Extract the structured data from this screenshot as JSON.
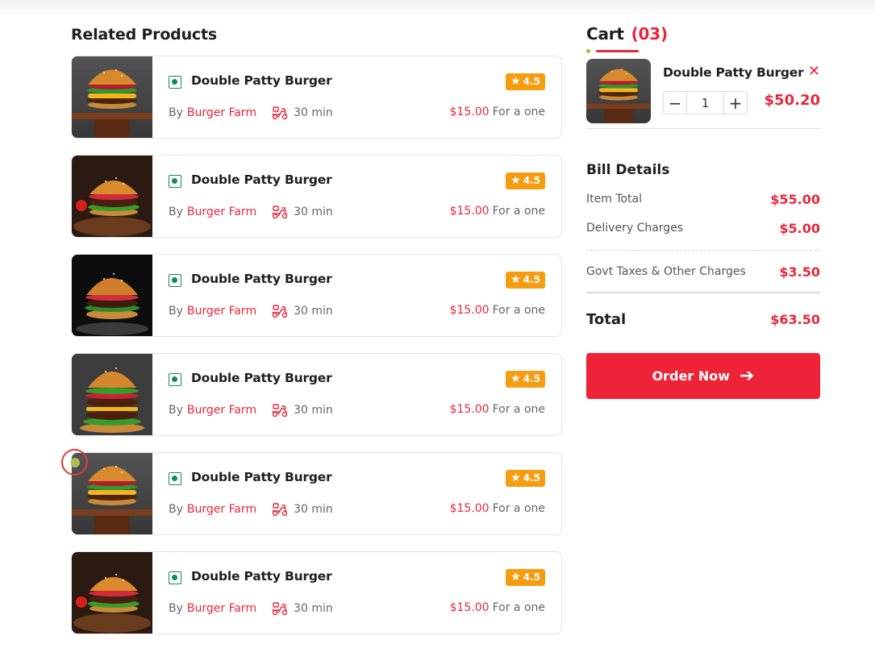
{
  "related": {
    "title": "Related Products",
    "products": [
      {
        "name": "Double Patty Burger",
        "rating": "4.5",
        "by_label": "By",
        "brand": "Burger Farm",
        "time": "30 min",
        "price": "$15.00",
        "price_suffix": "For a one",
        "image": "burger-image-1"
      },
      {
        "name": "Double Patty Burger",
        "rating": "4.5",
        "by_label": "By",
        "brand": "Burger Farm",
        "time": "30 min",
        "price": "$15.00",
        "price_suffix": "For a one",
        "image": "burger-image-2"
      },
      {
        "name": "Double Patty Burger",
        "rating": "4.5",
        "by_label": "By",
        "brand": "Burger Farm",
        "time": "30 min",
        "price": "$15.00",
        "price_suffix": "For a one",
        "image": "burger-image-3"
      },
      {
        "name": "Double Patty Burger",
        "rating": "4.5",
        "by_label": "By",
        "brand": "Burger Farm",
        "time": "30 min",
        "price": "$15.00",
        "price_suffix": "For a one",
        "image": "burger-image-4"
      },
      {
        "name": "Double Patty Burger",
        "rating": "4.5",
        "by_label": "By",
        "brand": "Burger Farm",
        "time": "30 min",
        "price": "$15.00",
        "price_suffix": "For a one",
        "image": "burger-image-5"
      },
      {
        "name": "Double Patty Burger",
        "rating": "4.5",
        "by_label": "By",
        "brand": "Burger Farm",
        "time": "30 min",
        "price": "$15.00",
        "price_suffix": "For a one",
        "image": "burger-image-6"
      }
    ]
  },
  "cart": {
    "title": "Cart",
    "count": "(03)",
    "item": {
      "name": "Double Patty Burger",
      "quantity": "1",
      "total": "$50.20",
      "remove_icon": "close-icon",
      "minus_icon": "minus-icon",
      "plus_icon": "plus-icon"
    }
  },
  "bill": {
    "title": "Bill Details",
    "item_total_label": "Item Total",
    "item_total": "$55.00",
    "delivery_label": "Delivery Charges",
    "delivery": "$5.00",
    "taxes_label": "Govt Taxes & Other Charges",
    "taxes": "$3.50",
    "total_label": "Total",
    "total": "$63.50"
  },
  "order_button": {
    "label": "Order Now",
    "icon": "arrow-right-icon"
  },
  "colors": {
    "accent": "#ee2338",
    "rating_badge": "#f59d10",
    "veg_mark": "#128a5b"
  }
}
